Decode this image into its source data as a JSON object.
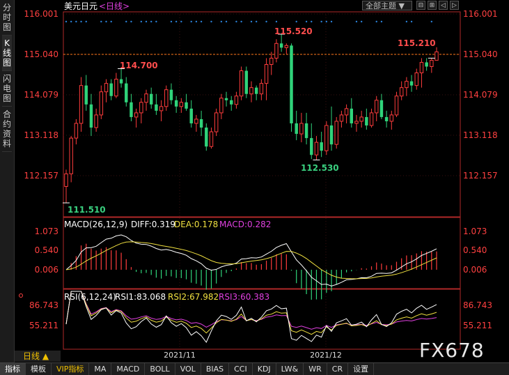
{
  "sidebar": {
    "tabs": [
      "分时图",
      "K线图",
      "闪电图",
      "合约资料"
    ],
    "active": 1
  },
  "header": {
    "symbol": "美元日元",
    "period_label": "<日线>"
  },
  "theme_selector": {
    "label": "全部主题"
  },
  "toolbar_buttons": [
    "⊟",
    "⊞",
    "◁",
    "▷"
  ],
  "main_price_labels": [
    "116.001",
    "115.040",
    "114.079",
    "113.118",
    "112.157"
  ],
  "annotations": {
    "hi1": "114.700",
    "hi2": "115.520",
    "hi3": "115.210",
    "lo1": "111.510",
    "lo2": "112.530"
  },
  "macd": {
    "title": "MACD(26,12,9)",
    "diff": "DIFF:0.319",
    "dea": "DEA:0.178",
    "macd": "MACD:0.282",
    "ticks": [
      "1.073",
      "0.540",
      "0.006"
    ]
  },
  "rsi": {
    "title": "RSI(6,12,24)",
    "rsi1": "RSI1:83.068",
    "rsi2": "RSI2:67.982",
    "rsi3": "RSI3:60.383",
    "ticks": [
      "86.743",
      "55.211"
    ]
  },
  "x_labels": [
    "2021/11",
    "2021/12"
  ],
  "period_button": "日线 ▲",
  "bottom_bar": [
    "指标",
    "模板",
    "VIP指标",
    "MA",
    "MACD",
    "BOLL",
    "VOL",
    "BIAS",
    "CCI",
    "KDJ",
    "LW&",
    "WR",
    "CR",
    "设置"
  ],
  "watermark": "FX678",
  "colors": {
    "up": "#ff3c3c",
    "down": "#2fd37a",
    "grid": "#b02828",
    "price_line": "#ff7a1a",
    "diff": "#ffffff",
    "dea": "#f0e040",
    "macd_label": "#e040e0",
    "dots": "#2a7fd4"
  },
  "chart_data": {
    "type": "candlestick",
    "symbol": "美元日元",
    "period": "日线",
    "current_price": 115.04,
    "ylim": [
      111.2,
      116.3
    ],
    "candles": [
      {
        "o": 111.9,
        "h": 112.3,
        "l": 111.51,
        "c": 112.2
      },
      {
        "o": 112.2,
        "h": 113.1,
        "l": 112.0,
        "c": 113.05
      },
      {
        "o": 113.05,
        "h": 113.5,
        "l": 112.9,
        "c": 113.4
      },
      {
        "o": 113.4,
        "h": 114.5,
        "l": 113.2,
        "c": 114.3
      },
      {
        "o": 114.3,
        "h": 114.55,
        "l": 113.7,
        "c": 113.85
      },
      {
        "o": 113.85,
        "h": 114.1,
        "l": 113.1,
        "c": 113.3
      },
      {
        "o": 113.3,
        "h": 113.75,
        "l": 113.2,
        "c": 113.6
      },
      {
        "o": 113.6,
        "h": 114.3,
        "l": 113.5,
        "c": 114.15
      },
      {
        "o": 114.15,
        "h": 114.45,
        "l": 113.9,
        "c": 114.35
      },
      {
        "o": 114.35,
        "h": 114.45,
        "l": 113.95,
        "c": 114.05
      },
      {
        "o": 114.05,
        "h": 114.6,
        "l": 114.0,
        "c": 114.45
      },
      {
        "o": 114.45,
        "h": 114.7,
        "l": 114.25,
        "c": 114.35
      },
      {
        "o": 114.35,
        "h": 114.5,
        "l": 113.8,
        "c": 113.9
      },
      {
        "o": 113.9,
        "h": 114.1,
        "l": 113.45,
        "c": 113.55
      },
      {
        "o": 113.55,
        "h": 113.75,
        "l": 113.3,
        "c": 113.65
      },
      {
        "o": 113.65,
        "h": 114.0,
        "l": 113.4,
        "c": 113.9
      },
      {
        "o": 113.9,
        "h": 114.2,
        "l": 113.7,
        "c": 114.1
      },
      {
        "o": 114.1,
        "h": 114.25,
        "l": 113.75,
        "c": 113.85
      },
      {
        "o": 113.85,
        "h": 114.1,
        "l": 113.6,
        "c": 113.7
      },
      {
        "o": 113.7,
        "h": 113.95,
        "l": 113.45,
        "c": 113.8
      },
      {
        "o": 113.8,
        "h": 114.3,
        "l": 113.7,
        "c": 114.2
      },
      {
        "o": 114.2,
        "h": 114.35,
        "l": 113.85,
        "c": 113.95
      },
      {
        "o": 113.95,
        "h": 114.05,
        "l": 113.65,
        "c": 113.8
      },
      {
        "o": 113.8,
        "h": 114.0,
        "l": 113.65,
        "c": 113.9
      },
      {
        "o": 113.9,
        "h": 114.1,
        "l": 113.7,
        "c": 113.75
      },
      {
        "o": 113.75,
        "h": 113.95,
        "l": 113.3,
        "c": 113.4
      },
      {
        "o": 113.4,
        "h": 113.6,
        "l": 113.2,
        "c": 113.5
      },
      {
        "o": 113.5,
        "h": 113.7,
        "l": 113.1,
        "c": 113.3
      },
      {
        "o": 113.3,
        "h": 113.4,
        "l": 112.75,
        "c": 112.85
      },
      {
        "o": 112.85,
        "h": 113.3,
        "l": 112.8,
        "c": 113.2
      },
      {
        "o": 113.2,
        "h": 113.75,
        "l": 113.1,
        "c": 113.65
      },
      {
        "o": 113.65,
        "h": 114.1,
        "l": 113.5,
        "c": 114.0
      },
      {
        "o": 114.0,
        "h": 114.15,
        "l": 113.8,
        "c": 113.95
      },
      {
        "o": 113.95,
        "h": 114.05,
        "l": 113.7,
        "c": 113.85
      },
      {
        "o": 113.85,
        "h": 114.15,
        "l": 113.75,
        "c": 114.05
      },
      {
        "o": 114.05,
        "h": 114.75,
        "l": 113.95,
        "c": 114.65
      },
      {
        "o": 114.65,
        "h": 114.75,
        "l": 114.0,
        "c": 114.1
      },
      {
        "o": 114.1,
        "h": 114.4,
        "l": 113.9,
        "c": 114.25
      },
      {
        "o": 114.25,
        "h": 114.3,
        "l": 113.95,
        "c": 114.1
      },
      {
        "o": 114.1,
        "h": 114.45,
        "l": 113.95,
        "c": 114.35
      },
      {
        "o": 114.35,
        "h": 114.95,
        "l": 113.95,
        "c": 114.8
      },
      {
        "o": 114.8,
        "h": 115.1,
        "l": 114.55,
        "c": 114.95
      },
      {
        "o": 114.95,
        "h": 115.4,
        "l": 114.85,
        "c": 115.3
      },
      {
        "o": 115.3,
        "h": 115.52,
        "l": 115.1,
        "c": 115.2
      },
      {
        "o": 115.2,
        "h": 115.3,
        "l": 115.05,
        "c": 115.25
      },
      {
        "o": 115.25,
        "h": 115.3,
        "l": 113.2,
        "c": 113.4
      },
      {
        "o": 113.4,
        "h": 113.7,
        "l": 113.0,
        "c": 113.15
      },
      {
        "o": 113.15,
        "h": 113.65,
        "l": 112.95,
        "c": 113.4
      },
      {
        "o": 113.4,
        "h": 113.65,
        "l": 112.9,
        "c": 113.05
      },
      {
        "o": 113.05,
        "h": 113.4,
        "l": 112.55,
        "c": 112.65
      },
      {
        "o": 112.65,
        "h": 113.1,
        "l": 112.53,
        "c": 112.95
      },
      {
        "o": 112.95,
        "h": 113.2,
        "l": 112.6,
        "c": 112.75
      },
      {
        "o": 112.75,
        "h": 113.45,
        "l": 112.65,
        "c": 113.35
      },
      {
        "o": 113.35,
        "h": 113.8,
        "l": 112.75,
        "c": 112.9
      },
      {
        "o": 112.9,
        "h": 113.55,
        "l": 112.8,
        "c": 113.45
      },
      {
        "o": 113.45,
        "h": 113.7,
        "l": 113.3,
        "c": 113.6
      },
      {
        "o": 113.6,
        "h": 113.85,
        "l": 113.4,
        "c": 113.75
      },
      {
        "o": 113.75,
        "h": 114.0,
        "l": 113.3,
        "c": 113.4
      },
      {
        "o": 113.4,
        "h": 113.6,
        "l": 113.2,
        "c": 113.45
      },
      {
        "o": 113.45,
        "h": 113.7,
        "l": 113.3,
        "c": 113.55
      },
      {
        "o": 113.55,
        "h": 113.75,
        "l": 113.25,
        "c": 113.35
      },
      {
        "o": 113.35,
        "h": 113.75,
        "l": 113.3,
        "c": 113.65
      },
      {
        "o": 113.65,
        "h": 114.05,
        "l": 113.45,
        "c": 113.95
      },
      {
        "o": 113.95,
        "h": 114.1,
        "l": 113.5,
        "c": 113.55
      },
      {
        "o": 113.55,
        "h": 113.7,
        "l": 113.3,
        "c": 113.45
      },
      {
        "o": 113.45,
        "h": 113.7,
        "l": 113.25,
        "c": 113.6
      },
      {
        "o": 113.6,
        "h": 114.15,
        "l": 113.55,
        "c": 114.05
      },
      {
        "o": 114.05,
        "h": 114.4,
        "l": 113.95,
        "c": 114.25
      },
      {
        "o": 114.25,
        "h": 114.5,
        "l": 114.05,
        "c": 114.4
      },
      {
        "o": 114.4,
        "h": 114.55,
        "l": 114.15,
        "c": 114.3
      },
      {
        "o": 114.3,
        "h": 114.7,
        "l": 114.2,
        "c": 114.6
      },
      {
        "o": 114.6,
        "h": 114.95,
        "l": 114.25,
        "c": 114.85
      },
      {
        "o": 114.85,
        "h": 114.95,
        "l": 114.65,
        "c": 114.75
      },
      {
        "o": 114.75,
        "h": 114.95,
        "l": 114.6,
        "c": 114.9
      },
      {
        "o": 114.9,
        "h": 115.21,
        "l": 114.9,
        "c": 115.1
      }
    ],
    "macd": {
      "diff": 0.319,
      "dea": 0.178,
      "macd": 0.282,
      "ticks": [
        1.073,
        0.54,
        0.006
      ],
      "ylim": [
        -0.55,
        1.25
      ]
    },
    "rsi": {
      "rsi1": 83.068,
      "rsi2": 67.982,
      "rsi3": 60.383,
      "ticks": [
        86.743,
        55.211
      ],
      "ylim": [
        15,
        100
      ]
    },
    "x_labels": [
      "2021/11",
      "2021/12"
    ]
  }
}
